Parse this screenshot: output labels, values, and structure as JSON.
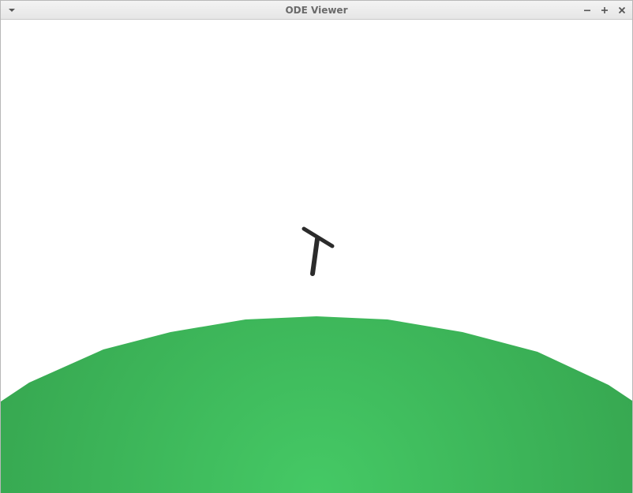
{
  "window": {
    "title": "ODE Viewer"
  },
  "titlebar_buttons": {
    "menu_icon": "chevron-down-icon",
    "minimize_icon": "minimize-icon",
    "maximize_icon": "maximize-icon",
    "close_icon": "close-icon"
  },
  "scene": {
    "background_color": "#ffffff",
    "ground_color_light": "#45c965",
    "ground_color_dark": "#37a851",
    "body_color": "#2b2b2b"
  }
}
